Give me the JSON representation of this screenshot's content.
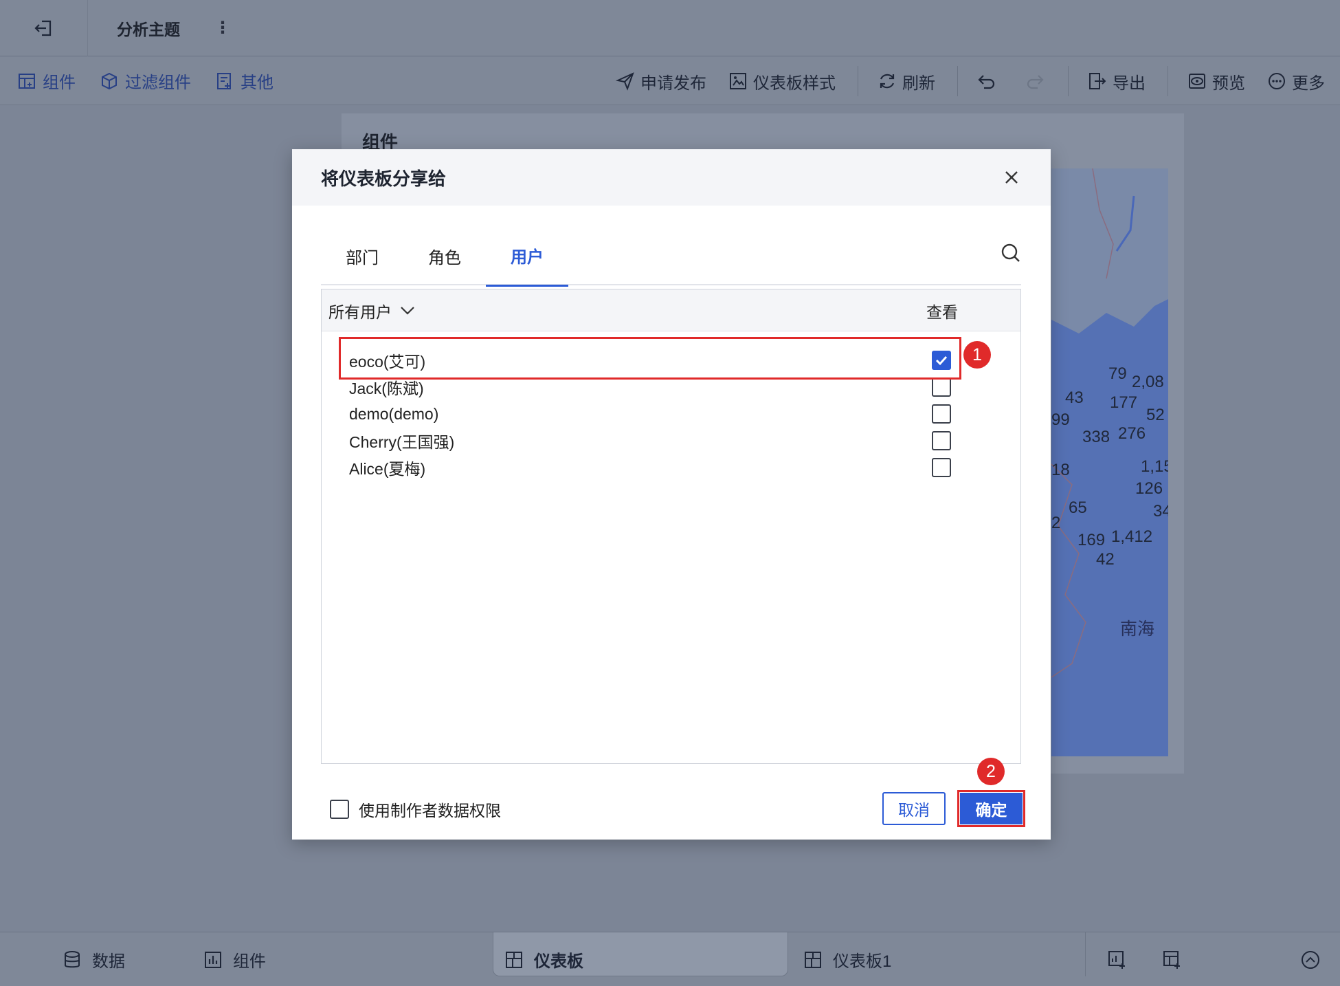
{
  "topbar": {
    "title": "分析主题",
    "more_glyph": "⋮"
  },
  "toolbar": {
    "left": [
      "组件",
      "过滤组件",
      "其他"
    ],
    "right": {
      "publish": "申请发布",
      "style": "仪表板样式",
      "refresh": "刷新",
      "export": "导出",
      "preview": "预览",
      "more": "更多"
    }
  },
  "canvas": {
    "card_title": "组件",
    "map_labels": [
      "79",
      "2,08",
      "43",
      "177",
      "99",
      "52",
      "338",
      "276",
      "18",
      "1,15",
      "126",
      "65",
      "34",
      "2",
      "169",
      "1,412",
      "42"
    ],
    "map_sea": "南海"
  },
  "modal": {
    "title": "将仪表板分享给",
    "tabs": [
      "部门",
      "角色",
      "用户"
    ],
    "active_tab": "用户",
    "filter_label": "所有用户",
    "column_view": "查看",
    "users": [
      {
        "name": "eoco(艾可)",
        "checked": true
      },
      {
        "name": "Jack(陈斌)",
        "checked": false
      },
      {
        "name": "demo(demo)",
        "checked": false
      },
      {
        "name": "Cherry(王国强)",
        "checked": false
      },
      {
        "name": "Alice(夏梅)",
        "checked": false
      }
    ],
    "use_creator_permission": "使用制作者数据权限",
    "cancel": "取消",
    "confirm": "确定",
    "badges": [
      "1",
      "2"
    ]
  },
  "bottombar": {
    "data": "数据",
    "component": "组件",
    "dashboard": "仪表板",
    "dashboard1": "仪表板1"
  },
  "colors": {
    "accent": "#2c5bd6",
    "highlight": "#e02a2a"
  }
}
